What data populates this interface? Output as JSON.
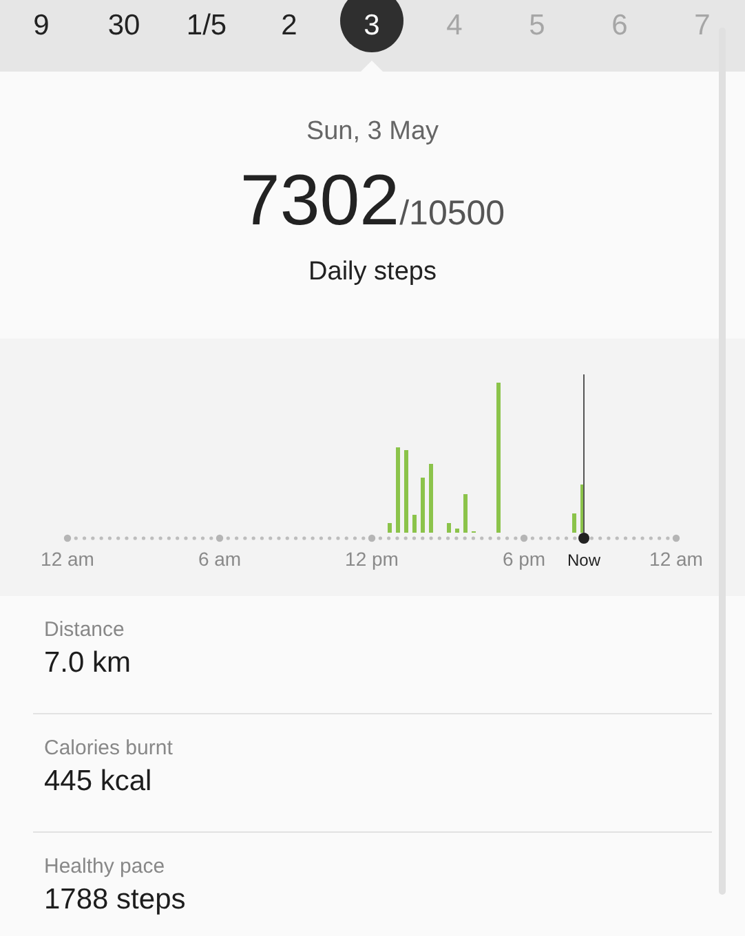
{
  "date_strip": [
    {
      "label": "9",
      "selected": false,
      "future": false
    },
    {
      "label": "30",
      "selected": false,
      "future": false
    },
    {
      "label": "1/5",
      "selected": false,
      "future": false
    },
    {
      "label": "2",
      "selected": false,
      "future": false
    },
    {
      "label": "3",
      "selected": true,
      "future": false
    },
    {
      "label": "4",
      "selected": false,
      "future": true
    },
    {
      "label": "5",
      "selected": false,
      "future": true
    },
    {
      "label": "6",
      "selected": false,
      "future": true
    },
    {
      "label": "7",
      "selected": false,
      "future": true
    }
  ],
  "summary": {
    "date": "Sun, 3 May",
    "steps": "7302",
    "goal": "/10500",
    "caption": "Daily steps"
  },
  "chart": {
    "x_labels": [
      "12 am",
      "6 am",
      "12 pm",
      "6 pm",
      "12 am"
    ],
    "now_label": "Now"
  },
  "stats": [
    {
      "label": "Distance",
      "value": "7.0 km"
    },
    {
      "label": "Calories burnt",
      "value": "445 kcal"
    },
    {
      "label": "Healthy pace",
      "value": "1788 steps"
    }
  ]
}
